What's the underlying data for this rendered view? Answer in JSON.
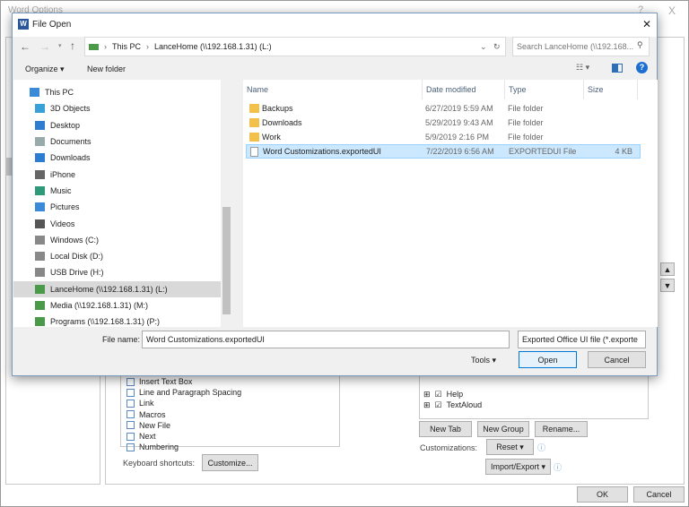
{
  "word_options": {
    "title": "Word Options",
    "help": "?",
    "close": "X",
    "commands": [
      "Insert Text Box",
      "Line and Paragraph Spacing",
      "Link",
      "Macros",
      "New File",
      "Next",
      "Numbering"
    ],
    "keyboard_shortcuts_label": "Keyboard shortcuts:",
    "customize": "Customize...",
    "tree": [
      "Help",
      "TextAloud"
    ],
    "new_tab": "New Tab",
    "new_group": "New Group",
    "rename": "Rename...",
    "customizations_label": "Customizations:",
    "reset": "Reset ▾",
    "import_export": "Import/Export ▾",
    "ok": "OK",
    "cancel": "Cancel"
  },
  "dialog": {
    "title": "File Open",
    "close": "✕",
    "breadcrumb": [
      "This PC",
      "LanceHome (\\\\192.168.1.31) (L:)"
    ],
    "search_placeholder": "Search LanceHome (\\\\192.168...",
    "organize": "Organize ▾",
    "new_folder": "New folder",
    "nav": [
      {
        "label": "This PC",
        "icon": "pc"
      },
      {
        "label": "3D Objects",
        "icon": "cube"
      },
      {
        "label": "Desktop",
        "icon": "desktop"
      },
      {
        "label": "Documents",
        "icon": "doc"
      },
      {
        "label": "Downloads",
        "icon": "download"
      },
      {
        "label": "iPhone",
        "icon": "phone"
      },
      {
        "label": "Music",
        "icon": "music"
      },
      {
        "label": "Pictures",
        "icon": "pic"
      },
      {
        "label": "Videos",
        "icon": "video"
      },
      {
        "label": "Windows (C:)",
        "icon": "drive"
      },
      {
        "label": "Local Disk (D:)",
        "icon": "drive"
      },
      {
        "label": "USB Drive (H:)",
        "icon": "drive"
      },
      {
        "label": "LanceHome (\\\\192.168.1.31) (L:)",
        "icon": "net"
      },
      {
        "label": "Media (\\\\192.168.1.31) (M:)",
        "icon": "net"
      },
      {
        "label": "Programs (\\\\192.168.1.31) (P:)",
        "icon": "net"
      }
    ],
    "columns": [
      "Name",
      "Date modified",
      "Type",
      "Size"
    ],
    "files": [
      {
        "name": "Backups",
        "date": "6/27/2019 5:59 AM",
        "type": "File folder",
        "size": ""
      },
      {
        "name": "Downloads",
        "date": "5/29/2019 9:43 AM",
        "type": "File folder",
        "size": ""
      },
      {
        "name": "Work",
        "date": "5/9/2019 2:16 PM",
        "type": "File folder",
        "size": ""
      },
      {
        "name": "Word Customizations.exportedUI",
        "date": "7/22/2019 6:56 AM",
        "type": "EXPORTEDUI File",
        "size": "4 KB"
      }
    ],
    "file_name_label": "File name:",
    "file_name": "Word Customizations.exportedUI",
    "file_type": "Exported Office UI file (*.exporte",
    "tools": "Tools ▾",
    "open": "Open",
    "cancel": "Cancel"
  }
}
